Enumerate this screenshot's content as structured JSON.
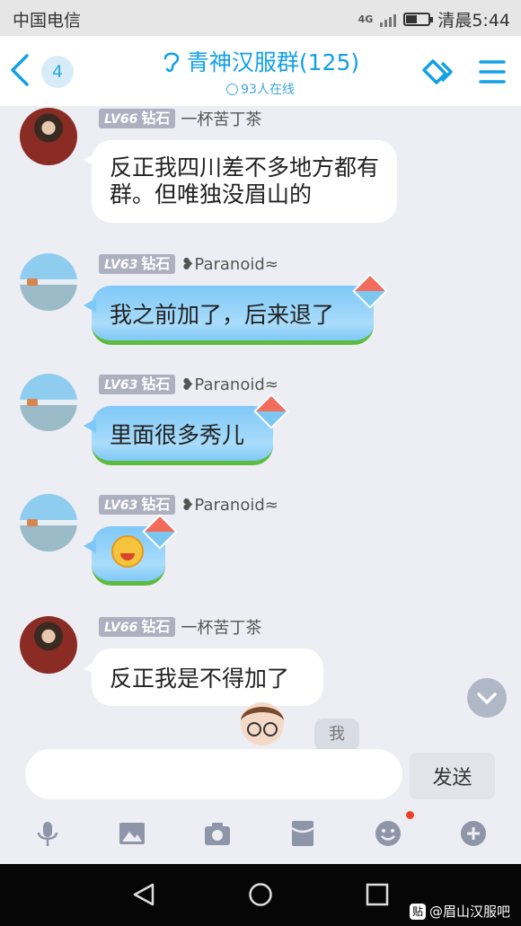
{
  "status_bar": {
    "carrier": "中国电信",
    "network": "4G",
    "time": "清晨5:44"
  },
  "header": {
    "unread_count": "4",
    "title": "青神汉服群(125)",
    "online_text": "93人在线",
    "icons": [
      "back-arrow-icon",
      "ear-icon",
      "group-link-icon",
      "menu-icon"
    ],
    "accent_color": "#12a0e6"
  },
  "messages": [
    {
      "level": "LV66",
      "rank": "钻石",
      "name": "一杯苦丁茶",
      "text_lines": [
        "反正我四川差不多地方都有",
        "群。但唯独没眉山的"
      ],
      "bubble": "white"
    },
    {
      "level": "LV63",
      "rank": "钻石",
      "name": "❥Paranoid≈",
      "text": "我之前加了，后来退了",
      "bubble": "sky"
    },
    {
      "level": "LV63",
      "rank": "钻石",
      "name": "❥Paranoid≈",
      "text": "里面很多秀儿",
      "bubble": "sky"
    },
    {
      "level": "LV63",
      "rank": "钻石",
      "name": "❥Paranoid≈",
      "text": "",
      "emoji": "laughing-crying-emoji",
      "bubble": "sky"
    },
    {
      "level": "LV66",
      "rank": "钻石",
      "name": "一杯苦丁茶",
      "text": "反正我是不得加了",
      "bubble": "white"
    }
  ],
  "partial_bubble": "我",
  "input": {
    "value": "",
    "placeholder": ""
  },
  "send_label": "发送",
  "toolbar_icons": [
    "microphone-icon",
    "image-icon",
    "camera-icon",
    "red-packet-icon",
    "emoji-icon",
    "plus-icon"
  ],
  "watermark": "@眉山汉服吧"
}
